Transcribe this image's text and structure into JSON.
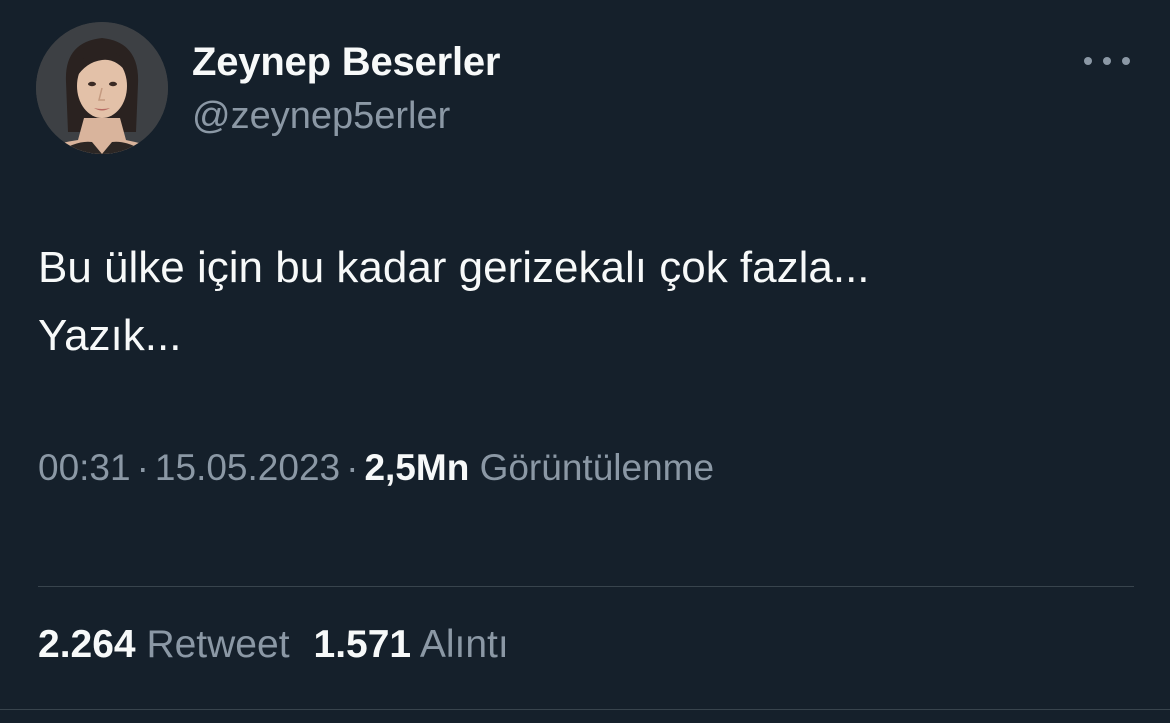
{
  "author": {
    "display_name": "Zeynep Beserler",
    "handle": "@zeynep5erler"
  },
  "more_icon": "more-horizontal-icon",
  "tweet": {
    "lines": [
      "Bu ülke için bu kadar gerizekalı çok fazla...",
      "Yazık..."
    ]
  },
  "meta": {
    "time": "00:31",
    "separator": "·",
    "date": "15.05.2023",
    "views_count": "2,5Mn",
    "views_label": "Görüntülenme"
  },
  "stats": {
    "retweets_count": "2.264",
    "retweets_label": "Retweet",
    "quotes_count": "1.571",
    "quotes_label": "Alıntı"
  },
  "colors": {
    "background": "#15202b",
    "primary_text": "#f7f9f9",
    "secondary_text": "#8b98a5",
    "divider": "#38444d"
  }
}
